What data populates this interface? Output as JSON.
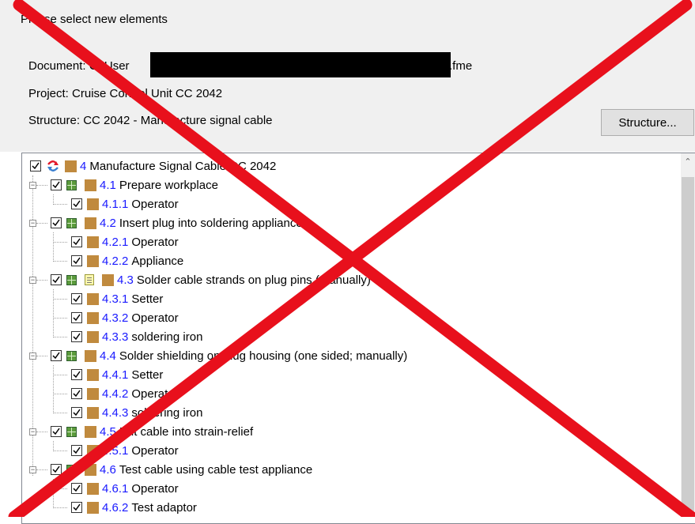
{
  "dialog": {
    "instruction": "Please select new elements",
    "document_label": "Document: C:\\User",
    "document_suffix": ".fme",
    "project_label": "Project: Cruise Control Unit CC 2042",
    "structure_label": "Structure: CC 2042 - Manufacture signal cable",
    "structure_button": "Structure..."
  },
  "tree": {
    "items": [
      {
        "num": "4",
        "label": "Manufacture Signal Cable CC 2042",
        "checked": true
      },
      {
        "num": "4.1",
        "label": "Prepare workplace",
        "checked": true
      },
      {
        "num": "4.1.1",
        "label": "Operator",
        "checked": true
      },
      {
        "num": "4.2",
        "label": "Insert plug into soldering appliance",
        "checked": true
      },
      {
        "num": "4.2.1",
        "label": "Operator",
        "checked": true
      },
      {
        "num": "4.2.2",
        "label": "Appliance",
        "checked": true
      },
      {
        "num": "4.3",
        "label": "Solder cable strands on plug pins (manually)",
        "checked": true
      },
      {
        "num": "4.3.1",
        "label": "Setter",
        "checked": true
      },
      {
        "num": "4.3.2",
        "label": "Operator",
        "checked": true
      },
      {
        "num": "4.3.3",
        "label": "soldering iron",
        "checked": true
      },
      {
        "num": "4.4",
        "label": "Solder shielding on plug housing (one sided; manually)",
        "checked": true
      },
      {
        "num": "4.4.1",
        "label": "Setter",
        "checked": true
      },
      {
        "num": "4.4.2",
        "label": "Operator",
        "checked": true
      },
      {
        "num": "4.4.3",
        "label": "soldering iron",
        "checked": true
      },
      {
        "num": "4.5",
        "label": "Put cable into strain-relief",
        "checked": true
      },
      {
        "num": "4.5.1",
        "label": "Operator",
        "checked": true
      },
      {
        "num": "4.6",
        "label": "Test cable using cable test appliance",
        "checked": true
      },
      {
        "num": "4.6.1",
        "label": "Operator",
        "checked": true
      },
      {
        "num": "4.6.2",
        "label": "Test adaptor",
        "checked": true
      }
    ]
  },
  "colors": {
    "background": "#f0f0f0",
    "number_link": "#1a1aff",
    "element_square": "#c08a3e",
    "cross_overlay": "#e8101c"
  },
  "icons": {
    "check": "check-icon",
    "process": "process-arrows-icon",
    "grid": "grid-table-icon",
    "note": "note-icon"
  }
}
